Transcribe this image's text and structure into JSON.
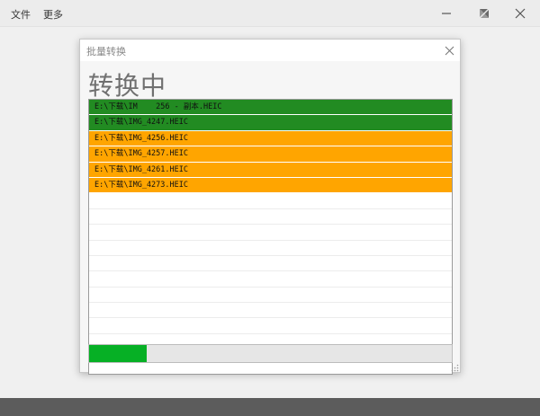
{
  "menu": {
    "file_label": "文件",
    "more_label": "更多"
  },
  "dialog": {
    "title": "批量转换",
    "status_heading": "转换中"
  },
  "files": [
    {
      "path": "E:\\下载\\IM    256 - 副本.HEIC",
      "state": "done"
    },
    {
      "path": "E:\\下载\\IMG_4247.HEIC",
      "state": "done"
    },
    {
      "path": "E:\\下载\\IMG_4256.HEIC",
      "state": "pending"
    },
    {
      "path": "E:\\下载\\IMG_4257.HEIC",
      "state": "pending"
    },
    {
      "path": "E:\\下载\\IMG_4261.HEIC",
      "state": "pending"
    },
    {
      "path": "E:\\下载\\IMG_4273.HEIC",
      "state": "pending"
    }
  ],
  "progress": {
    "fraction": 0.16
  },
  "colors": {
    "done": "#228b22",
    "pending": "#ffa500",
    "progress_fill": "#06b025"
  },
  "icons": {
    "minimize": "minimize-icon",
    "restore": "restore-icon",
    "close": "close-icon"
  }
}
